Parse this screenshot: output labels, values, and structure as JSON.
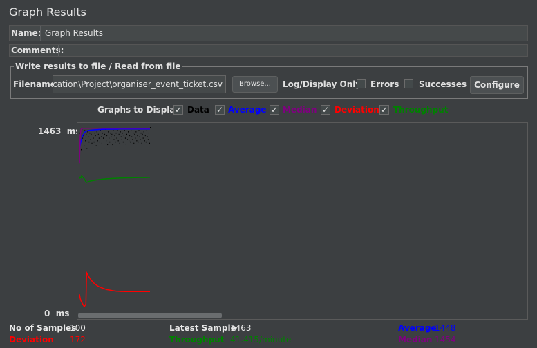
{
  "title": "Graph Results",
  "name": {
    "label": "Name:",
    "value": "Graph Results"
  },
  "comments": {
    "label": "Comments:"
  },
  "file_section": {
    "legend": "Write results to file / Read from file",
    "filename_label": "Filename",
    "filename_value": "erification\\Project\\organiser_event_ticket.csv",
    "browse": "Browse...",
    "log_display_only": "Log/Display Only:",
    "errors": "Errors",
    "successes": "Successes",
    "configure": "Configure"
  },
  "graphs_to_display": {
    "label": "Graphs to Display",
    "items": [
      {
        "label": "Data",
        "color": "#000000",
        "checked": true
      },
      {
        "label": "Average",
        "color": "#0000ff",
        "checked": true
      },
      {
        "label": "Median",
        "color": "#800080",
        "checked": true
      },
      {
        "label": "Deviation",
        "color": "#ff0000",
        "checked": true
      },
      {
        "label": "Throughput",
        "color": "#008000",
        "checked": true
      }
    ]
  },
  "axis": {
    "top": "1463",
    "top_unit": "ms",
    "bottom": "0",
    "bottom_unit": "ms"
  },
  "stats": {
    "no_samples_label": "No of Samples",
    "no_samples_value": "100",
    "latest_label": "Latest Sample",
    "latest_value": "1463",
    "average_label": "Average",
    "average_value": "1448",
    "deviation_label": "Deviation",
    "deviation_value": "172",
    "throughput_label": "Throughput",
    "throughput_value": "41.415/minute",
    "median_label": "Median",
    "median_value": "1454"
  },
  "chart_data": {
    "type": "line",
    "ylim": [
      0,
      1463
    ],
    "series": [
      {
        "name": "Data",
        "values": [
          1420,
          1350,
          1290,
          1450,
          1380,
          1400,
          1320,
          1440,
          1360,
          1410,
          1300,
          1430,
          1390,
          1350,
          1420,
          1370,
          1410,
          1340,
          1440,
          1380,
          1350,
          1420,
          1400,
          1320,
          1430,
          1360,
          1410,
          1380,
          1350,
          1440,
          1390,
          1340,
          1420,
          1380,
          1300,
          1410,
          1450,
          1360,
          1400,
          1330,
          1430,
          1380,
          1350,
          1420,
          1390,
          1410,
          1330,
          1440,
          1370,
          1400,
          1350,
          1420,
          1380,
          1440,
          1360,
          1410,
          1340,
          1430,
          1390,
          1370,
          1420,
          1350,
          1400,
          1440,
          1380,
          1330,
          1410,
          1370,
          1430,
          1360,
          1400,
          1350,
          1440,
          1390,
          1370,
          1420,
          1340,
          1410,
          1380,
          1430,
          1360,
          1400,
          1350,
          1440,
          1390,
          1370,
          1420,
          1340,
          1410,
          1380,
          1430,
          1360,
          1400,
          1350,
          1440,
          1390,
          1370,
          1420,
          1340,
          1463
        ]
      },
      {
        "name": "Average",
        "values": [
          1290,
          1320,
          1350,
          1370,
          1390,
          1400,
          1410,
          1420,
          1425,
          1430,
          1432,
          1434,
          1436,
          1437,
          1438,
          1438,
          1439,
          1440,
          1440,
          1441,
          1441,
          1442,
          1442,
          1442,
          1443,
          1443,
          1443,
          1444,
          1444,
          1444,
          1444,
          1445,
          1445,
          1445,
          1445,
          1445,
          1446,
          1446,
          1446,
          1446,
          1446,
          1446,
          1446,
          1447,
          1447,
          1447,
          1447,
          1447,
          1447,
          1447,
          1447,
          1447,
          1447,
          1447,
          1447,
          1448,
          1448,
          1448,
          1448,
          1448,
          1448,
          1448,
          1448,
          1448,
          1448,
          1448,
          1448,
          1448,
          1448,
          1448,
          1448,
          1448,
          1448,
          1448,
          1448,
          1448,
          1448,
          1448,
          1448,
          1448,
          1448,
          1448,
          1448,
          1448,
          1448,
          1448,
          1448,
          1448,
          1448,
          1448,
          1448,
          1448,
          1448,
          1448,
          1448,
          1448,
          1448,
          1448,
          1448,
          1448
        ]
      },
      {
        "name": "Median",
        "values": [
          1180,
          1390,
          1440,
          1450,
          1452,
          1453,
          1453,
          1453,
          1454,
          1454,
          1454,
          1454,
          1454,
          1454,
          1454,
          1454,
          1454,
          1454,
          1454,
          1454,
          1454,
          1454,
          1454,
          1454,
          1454,
          1454,
          1454,
          1454,
          1454,
          1454,
          1454,
          1454,
          1454,
          1454,
          1454,
          1454,
          1454,
          1454,
          1454,
          1454,
          1454,
          1454,
          1454,
          1454,
          1454,
          1454,
          1454,
          1454,
          1454,
          1454,
          1454,
          1454,
          1454,
          1454,
          1454,
          1454,
          1454,
          1454,
          1454,
          1454,
          1454,
          1454,
          1454,
          1454,
          1454,
          1454,
          1454,
          1454,
          1454,
          1454,
          1454,
          1454,
          1454,
          1454,
          1454,
          1454,
          1454,
          1454,
          1454,
          1454,
          1454,
          1454,
          1454,
          1454,
          1454,
          1454,
          1454,
          1454,
          1454,
          1454,
          1454,
          1454,
          1454,
          1454,
          1454,
          1454,
          1454,
          1454,
          1454,
          1454
        ]
      },
      {
        "name": "Deviation",
        "values": [
          150,
          120,
          100,
          90,
          80,
          70,
          60,
          55,
          65,
          75,
          320,
          310,
          300,
          290,
          280,
          272,
          265,
          258,
          252,
          246,
          240,
          235,
          230,
          226,
          222,
          218,
          215,
          212,
          209,
          206,
          204,
          202,
          200,
          198,
          196,
          194,
          192,
          190,
          188,
          187,
          186,
          185,
          184,
          183,
          182,
          181,
          180,
          179,
          178,
          177,
          176,
          176,
          175,
          175,
          175,
          174,
          174,
          174,
          173,
          173,
          173,
          173,
          173,
          172,
          172,
          172,
          172,
          172,
          172,
          172,
          172,
          172,
          172,
          172,
          172,
          172,
          172,
          172,
          172,
          172,
          172,
          172,
          172,
          172,
          172,
          172,
          172,
          172,
          172,
          172,
          172,
          172,
          172,
          172,
          172,
          172,
          172,
          172,
          172,
          172
        ]
      },
      {
        "name": "Throughput",
        "values": [
          1060,
          1070,
          1065,
          1080,
          1075,
          1068,
          1062,
          1055,
          1045,
          1035,
          1030,
          1032,
          1034,
          1036,
          1038,
          1040,
          1041,
          1042,
          1043,
          1044,
          1045,
          1046,
          1047,
          1048,
          1049,
          1050,
          1050,
          1051,
          1052,
          1052,
          1053,
          1054,
          1054,
          1055,
          1055,
          1056,
          1056,
          1057,
          1057,
          1058,
          1058,
          1058,
          1059,
          1059,
          1059,
          1060,
          1060,
          1060,
          1061,
          1061,
          1061,
          1061,
          1062,
          1062,
          1062,
          1062,
          1063,
          1063,
          1063,
          1063,
          1063,
          1064,
          1064,
          1064,
          1064,
          1064,
          1064,
          1065,
          1065,
          1065,
          1065,
          1065,
          1065,
          1065,
          1066,
          1066,
          1066,
          1066,
          1066,
          1066,
          1066,
          1066,
          1066,
          1067,
          1067,
          1067,
          1067,
          1067,
          1067,
          1067,
          1067,
          1067,
          1067,
          1067,
          1067,
          1067,
          1068,
          1068,
          1068,
          1068
        ]
      }
    ]
  }
}
